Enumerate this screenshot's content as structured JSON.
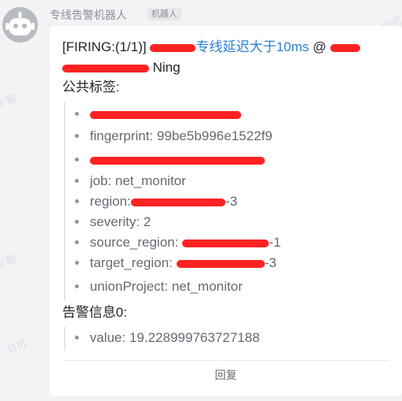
{
  "message": {
    "sender_name": "专线告警机器人",
    "bot_tag": "机器人",
    "header": {
      "prefix": "[FIRING:(1/1)]",
      "link_text": "专线延迟大于10ms",
      "mention": "@",
      "mention_suffix": "Ning"
    },
    "labels_title": "公共标签:",
    "labels": [
      {
        "text": ""
      },
      {
        "text": "fingerprint: 99be5b996e1522f9"
      },
      {
        "text": ""
      },
      {
        "text": "job: net_monitor"
      },
      {
        "text": "region:",
        "suffix": "-3"
      },
      {
        "text": "severity: 2"
      },
      {
        "text": "source_region:",
        "suffix": "-1"
      },
      {
        "text": "target_region:",
        "suffix": "-3"
      },
      {
        "text": "unionProject: net_monitor"
      }
    ],
    "info_title": "告警信息0:",
    "info": [
      {
        "text": "value: 19.228999763727188"
      }
    ],
    "reply_label": "回复"
  },
  "watermark": {
    "left": "宁副",
    "right": "宁可",
    "mid": "可可"
  }
}
